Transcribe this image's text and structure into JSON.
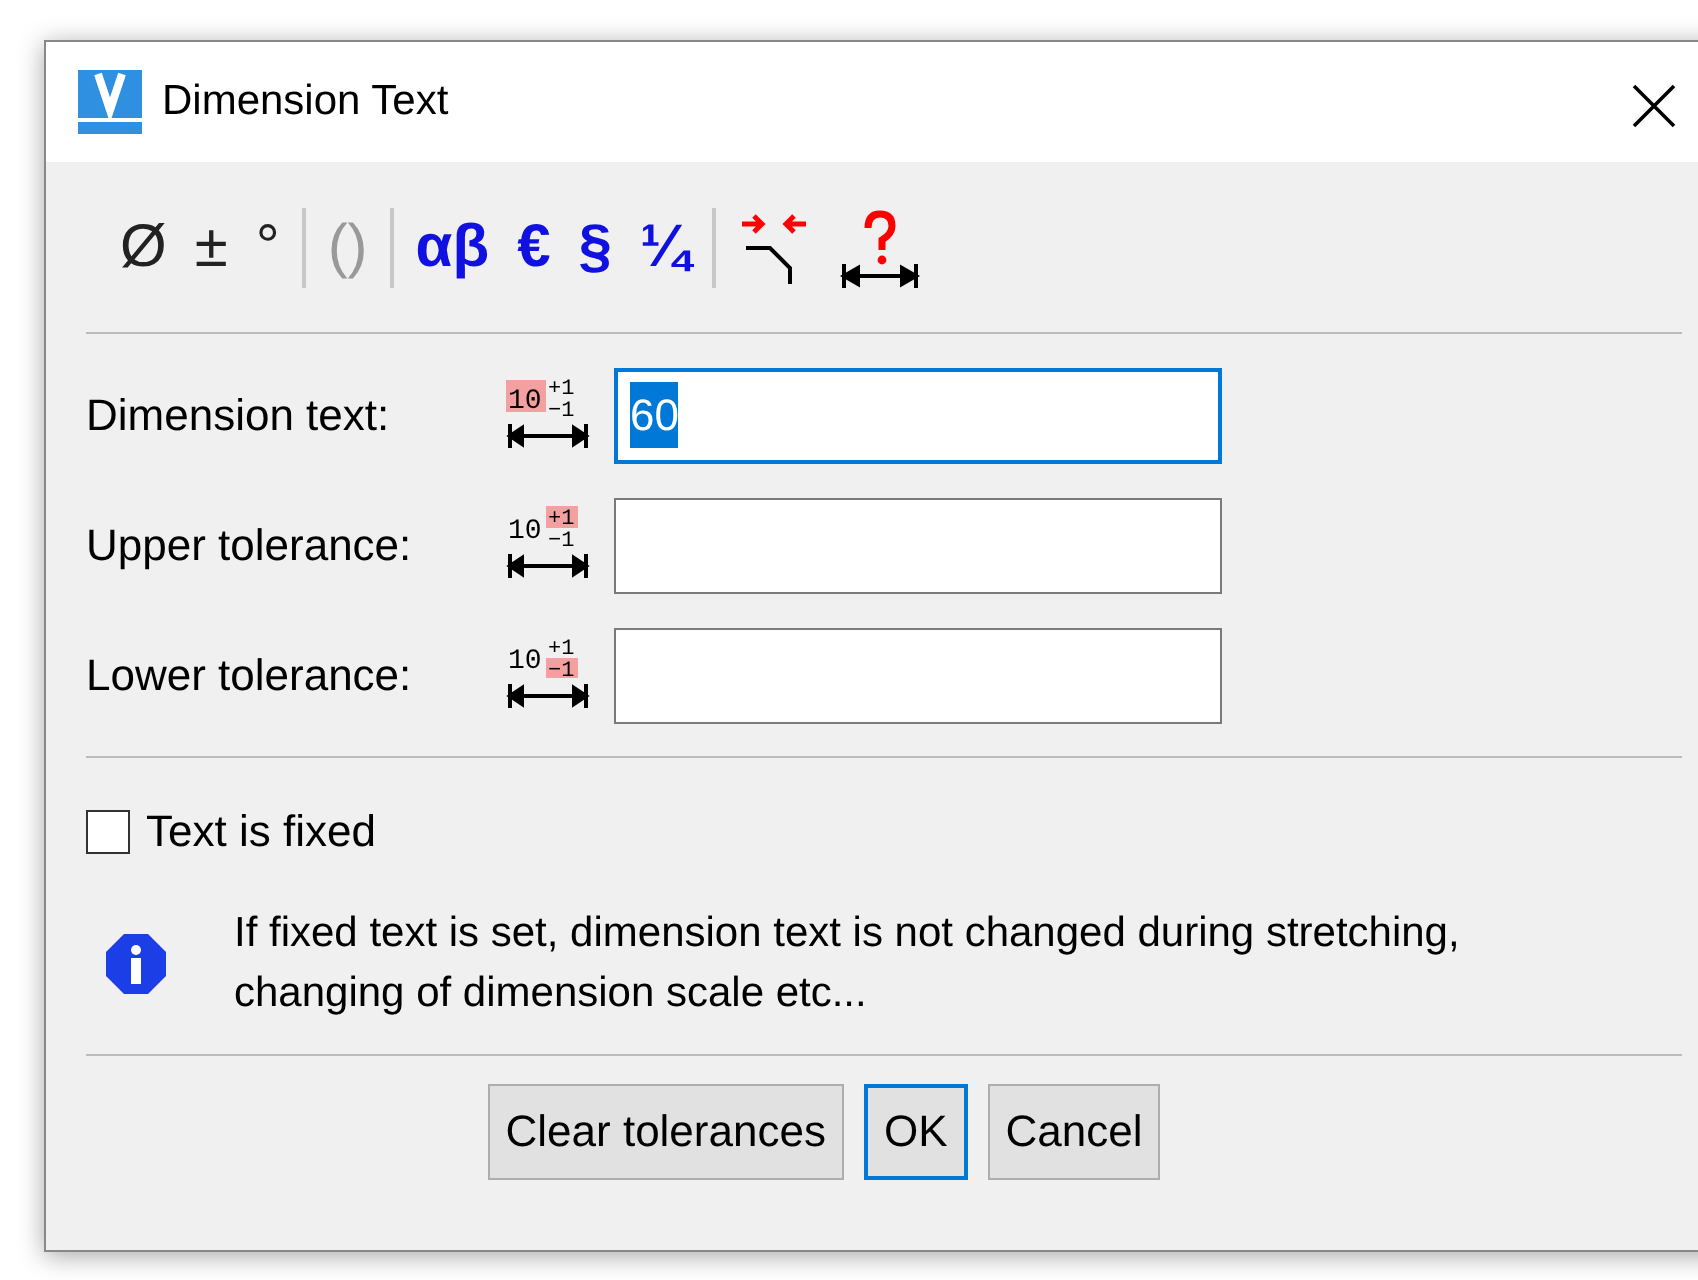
{
  "window": {
    "title": "Dimension Text"
  },
  "toolbar": [
    {
      "kind": "symbol",
      "text": "Ø",
      "disabled": false
    },
    {
      "kind": "symbol",
      "text": "±",
      "disabled": false
    },
    {
      "kind": "symbol",
      "text": "°",
      "disabled": false
    },
    {
      "kind": "separator"
    },
    {
      "kind": "symbol",
      "text": "()",
      "disabled": true
    },
    {
      "kind": "separator"
    },
    {
      "kind": "special",
      "text": "αβ",
      "disabled": false
    },
    {
      "kind": "special",
      "text": "€",
      "disabled": false
    },
    {
      "kind": "special",
      "text": "§",
      "disabled": false
    },
    {
      "kind": "special",
      "text": "¼",
      "disabled": false
    },
    {
      "kind": "separator"
    },
    {
      "kind": "break-line"
    },
    {
      "kind": "dimension-query"
    }
  ],
  "fields": [
    {
      "label": "Dimension text:",
      "value": "60",
      "focused": true,
      "icon": [
        {
          "text": "10",
          "marked": true
        },
        {
          "text": "+1",
          "marked": false
        },
        {
          "text": "−1",
          "marked": false
        }
      ]
    },
    {
      "label": "Upper tolerance:",
      "focused": false,
      "icon": [
        {
          "text": "10",
          "marked": false
        },
        {
          "text": "+1",
          "marked": true
        },
        {
          "text": "−1",
          "marked": false
        }
      ]
    },
    {
      "label": "Lower tolerance:",
      "focused": false,
      "icon": [
        {
          "text": "10",
          "marked": false
        },
        {
          "text": "+1",
          "marked": false
        },
        {
          "text": "−1",
          "marked": true
        }
      ]
    }
  ],
  "fixed_checkbox": {
    "label": "Text is fixed",
    "checked": false
  },
  "info": "If fixed text is set, dimension text is not changed during stretching, changing of dimension scale etc...",
  "buttons": [
    {
      "label": "Clear tolerances",
      "default": false
    },
    {
      "label": "OK",
      "default": true
    },
    {
      "label": "Cancel",
      "default": false
    }
  ]
}
